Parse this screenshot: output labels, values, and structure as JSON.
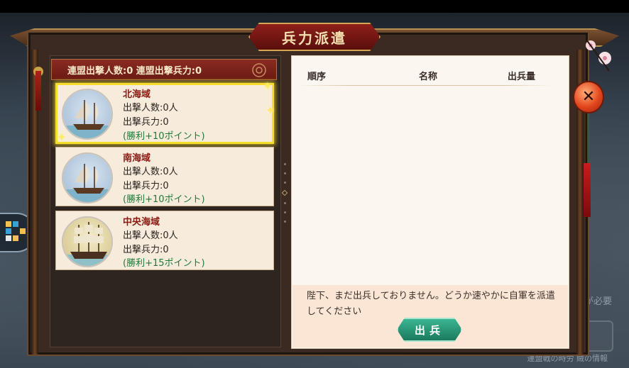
{
  "window": {
    "title": "兵力派遣"
  },
  "summary": {
    "text": "連盟出撃人数:0  連盟出撃兵力:0"
  },
  "seas": [
    {
      "name": "北海域",
      "people": "出撃人数:0人",
      "force": "出撃兵力:0",
      "bonus": "(勝利+10ポイント)",
      "selected": true
    },
    {
      "name": "南海域",
      "people": "出撃人数:0人",
      "force": "出撃兵力:0",
      "bonus": "(勝利+10ポイント)",
      "selected": false
    },
    {
      "name": "中央海域",
      "people": "出撃人数:0人",
      "force": "出撃兵力:0",
      "bonus": "(勝利+15ポイント)",
      "selected": false
    }
  ],
  "table": {
    "headers": [
      "順序",
      "名称",
      "出兵量"
    ]
  },
  "message": {
    "text": "陛下、まだ出兵しておりません。どうか速やかに自軍を派遣してください"
  },
  "deploy_button": {
    "label": "出兵"
  },
  "close_button": {
    "label": "✕"
  },
  "background": {
    "hint_right": "人が必要",
    "hint_bottom": "連盟戦の時労  賊の情報"
  },
  "colors": {
    "selected_border": "#f6dd2c",
    "bonus_green": "#1f7a3a",
    "sea_name_red": "#8a1a12",
    "deploy_green": "#2a9a78",
    "title_red": "#7a1a14"
  }
}
